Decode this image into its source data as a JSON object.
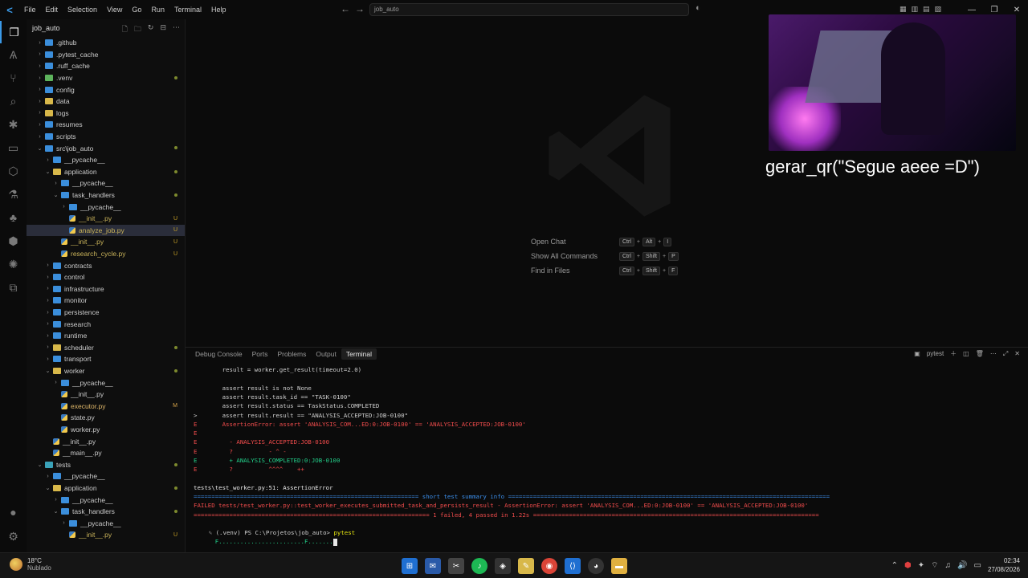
{
  "titlebar": {
    "logo": "<",
    "menu": [
      "File",
      "Edit",
      "Selection",
      "View",
      "Go",
      "Run",
      "Terminal",
      "Help"
    ],
    "search_text": "job_auto",
    "back": "←",
    "forward": "→"
  },
  "sidebar": {
    "title": "job_auto",
    "items": [
      {
        "label": ".github",
        "chev": "›",
        "indent": 0,
        "icon": "folder",
        "badge": ""
      },
      {
        "label": ".pytest_cache",
        "chev": "›",
        "indent": 0,
        "icon": "folder",
        "badge": ""
      },
      {
        "label": ".ruff_cache",
        "chev": "›",
        "indent": 0,
        "icon": "folder",
        "badge": ""
      },
      {
        "label": ".venv",
        "chev": "›",
        "indent": 0,
        "icon": "folder-g",
        "badge": "dot"
      },
      {
        "label": "config",
        "chev": "›",
        "indent": 0,
        "icon": "folder",
        "badge": ""
      },
      {
        "label": "data",
        "chev": "›",
        "indent": 0,
        "icon": "folder-y",
        "badge": ""
      },
      {
        "label": "logs",
        "chev": "›",
        "indent": 0,
        "icon": "folder-y",
        "badge": ""
      },
      {
        "label": "resumes",
        "chev": "›",
        "indent": 0,
        "icon": "folder",
        "badge": ""
      },
      {
        "label": "scripts",
        "chev": "›",
        "indent": 0,
        "icon": "folder",
        "badge": ""
      },
      {
        "label": "src\\job_auto",
        "chev": "⌄",
        "indent": 0,
        "icon": "folder",
        "badge": "dot"
      },
      {
        "label": "__pycache__",
        "chev": "›",
        "indent": 1,
        "icon": "folder",
        "badge": ""
      },
      {
        "label": "application",
        "chev": "⌄",
        "indent": 1,
        "icon": "folder-y",
        "badge": "dot"
      },
      {
        "label": "__pycache__",
        "chev": "›",
        "indent": 2,
        "icon": "folder",
        "badge": ""
      },
      {
        "label": "task_handlers",
        "chev": "⌄",
        "indent": 2,
        "icon": "folder",
        "badge": "dot"
      },
      {
        "label": "__pycache__",
        "chev": "›",
        "indent": 3,
        "icon": "folder",
        "badge": ""
      },
      {
        "label": "__init__.py",
        "chev": "",
        "indent": 3,
        "icon": "py",
        "badge": "U"
      },
      {
        "label": "analyze_job.py",
        "chev": "",
        "indent": 3,
        "icon": "py",
        "badge": "U",
        "selected": true
      },
      {
        "label": "__init__.py",
        "chev": "",
        "indent": 2,
        "icon": "py",
        "badge": "U"
      },
      {
        "label": "research_cycle.py",
        "chev": "",
        "indent": 2,
        "icon": "py",
        "badge": "U"
      },
      {
        "label": "contracts",
        "chev": "›",
        "indent": 1,
        "icon": "folder",
        "badge": ""
      },
      {
        "label": "control",
        "chev": "›",
        "indent": 1,
        "icon": "folder",
        "badge": ""
      },
      {
        "label": "infrastructure",
        "chev": "›",
        "indent": 1,
        "icon": "folder",
        "badge": ""
      },
      {
        "label": "monitor",
        "chev": "›",
        "indent": 1,
        "icon": "folder",
        "badge": ""
      },
      {
        "label": "persistence",
        "chev": "›",
        "indent": 1,
        "icon": "folder",
        "badge": ""
      },
      {
        "label": "research",
        "chev": "›",
        "indent": 1,
        "icon": "folder",
        "badge": ""
      },
      {
        "label": "runtime",
        "chev": "›",
        "indent": 1,
        "icon": "folder",
        "badge": ""
      },
      {
        "label": "scheduler",
        "chev": "›",
        "indent": 1,
        "icon": "folder-y",
        "badge": "dot"
      },
      {
        "label": "transport",
        "chev": "›",
        "indent": 1,
        "icon": "folder",
        "badge": ""
      },
      {
        "label": "worker",
        "chev": "⌄",
        "indent": 1,
        "icon": "folder-y",
        "badge": "dot"
      },
      {
        "label": "__pycache__",
        "chev": "›",
        "indent": 2,
        "icon": "folder",
        "badge": ""
      },
      {
        "label": "__init__.py",
        "chev": "",
        "indent": 2,
        "icon": "py",
        "badge": ""
      },
      {
        "label": "executor.py",
        "chev": "",
        "indent": 2,
        "icon": "py",
        "badge": "M"
      },
      {
        "label": "state.py",
        "chev": "",
        "indent": 2,
        "icon": "py",
        "badge": ""
      },
      {
        "label": "worker.py",
        "chev": "",
        "indent": 2,
        "icon": "py",
        "badge": ""
      },
      {
        "label": "__init__.py",
        "chev": "",
        "indent": 1,
        "icon": "py",
        "badge": ""
      },
      {
        "label": "__main__.py",
        "chev": "",
        "indent": 1,
        "icon": "py",
        "badge": ""
      },
      {
        "label": "tests",
        "chev": "⌄",
        "indent": 0,
        "icon": "folder-c",
        "badge": "dot"
      },
      {
        "label": "__pycache__",
        "chev": "›",
        "indent": 1,
        "icon": "folder",
        "badge": ""
      },
      {
        "label": "application",
        "chev": "⌄",
        "indent": 1,
        "icon": "folder-y",
        "badge": "dot"
      },
      {
        "label": "__pycache__",
        "chev": "›",
        "indent": 2,
        "icon": "folder",
        "badge": ""
      },
      {
        "label": "task_handlers",
        "chev": "⌄",
        "indent": 2,
        "icon": "folder",
        "badge": "dot"
      },
      {
        "label": "__pycache__",
        "chev": "›",
        "indent": 3,
        "icon": "folder",
        "badge": ""
      },
      {
        "label": "__init__.py",
        "chev": "",
        "indent": 3,
        "icon": "py",
        "badge": "U"
      }
    ]
  },
  "editor": {
    "shortcuts": [
      {
        "label": "Open Chat",
        "keys": [
          "Ctrl",
          "+",
          "Alt",
          "+",
          "I"
        ]
      },
      {
        "label": "Show All Commands",
        "keys": [
          "Ctrl",
          "+",
          "Shift",
          "+",
          "P"
        ]
      },
      {
        "label": "Find in Files",
        "keys": [
          "Ctrl",
          "+",
          "Shift",
          "+",
          "F"
        ]
      }
    ]
  },
  "overlay": {
    "caption": "gerar_qr(\"Segue aeee =D\")"
  },
  "panel": {
    "tabs": [
      "Debug Console",
      "Ports",
      "Problems",
      "Output",
      "Terminal"
    ],
    "active_tab": "Terminal",
    "shell_label": "pytest",
    "terminal_lines": [
      {
        "text": "        result = worker.get_result(timeout=2.0)",
        "cls": ""
      },
      {
        "text": "",
        "cls": ""
      },
      {
        "text": "        assert result is not None",
        "cls": ""
      },
      {
        "text": "        assert result.task_id == \"TASK-0100\"",
        "cls": ""
      },
      {
        "text": "        assert result.status == TaskStatus.COMPLETED",
        "cls": ""
      },
      {
        "text": ">       assert result.result == \"ANALYSIS_ACCEPTED:JOB-0100\"",
        "cls": ""
      },
      {
        "text": "E       AssertionError: assert 'ANALYSIS_COM...ED:0:JOB-0100' == 'ANALYSIS_ACCEPTED:JOB-0100'",
        "cls": "c-red"
      },
      {
        "text": "E",
        "cls": "c-red"
      },
      {
        "text": "E         - ANALYSIS_ACCEPTED:JOB-0100",
        "cls": "c-red"
      },
      {
        "text": "E         ?          - ^ -",
        "cls": "c-red"
      },
      {
        "text": "E         + ANALYSIS_COMPLETED:0:JOB-0100",
        "cls": "c-green"
      },
      {
        "text": "E         ?          ^^^^    ++",
        "cls": "c-red"
      },
      {
        "text": "",
        "cls": ""
      },
      {
        "text": "tests\\test_worker.py:51: AssertionError",
        "cls": "c-bold"
      }
    ],
    "summary_title": " short test summary info ",
    "failed_line": "FAILED tests/test_worker.py::test_worker_executes_submitted_task_and_persists_result - AssertionError: assert 'ANALYSIS_COM...ED:0:JOB-0100' == 'ANALYSIS_ACCEPTED:JOB-0100'",
    "result_summary": " 1 failed, 4 passed in 1.22s ",
    "prompt": "(.venv) PS C:\\Projetos\\job_auto> ",
    "command": "pytest",
    "progress": "F........................F......."
  },
  "taskbar": {
    "temp": "18°C",
    "weather": "Nublado",
    "time": "02:34",
    "date": "27/08/2026"
  }
}
